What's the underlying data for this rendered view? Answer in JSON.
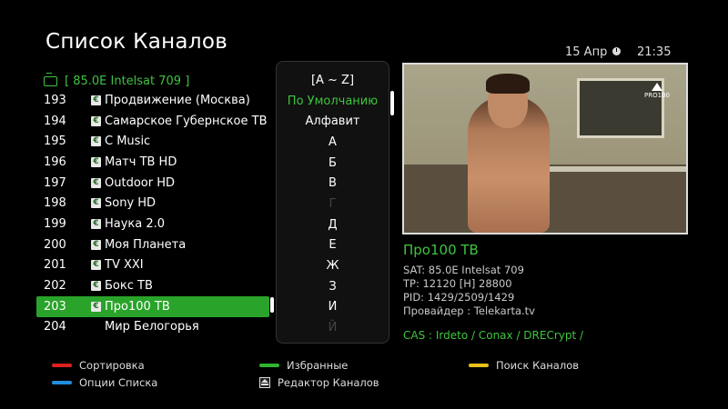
{
  "header": {
    "title": "Список Каналов",
    "date": "15 Апр",
    "time": "21:35"
  },
  "satellite": {
    "label": "[ 85.0E Intelsat 709 ]",
    "icon": "tv-icon",
    "color": "#3ec43e"
  },
  "channels": [
    {
      "num": "193",
      "name": "Продвижение (Москва)",
      "free": true
    },
    {
      "num": "194",
      "name": "Самарское Губернское ТВ",
      "free": true
    },
    {
      "num": "195",
      "name": "C Music",
      "free": true
    },
    {
      "num": "196",
      "name": "Матч ТВ HD",
      "free": true
    },
    {
      "num": "197",
      "name": "Outdoor HD",
      "free": true
    },
    {
      "num": "198",
      "name": "Sony HD",
      "free": true
    },
    {
      "num": "199",
      "name": "Наука 2.0",
      "free": true
    },
    {
      "num": "200",
      "name": "Моя Планета",
      "free": true
    },
    {
      "num": "201",
      "name": "TV XXI",
      "free": true
    },
    {
      "num": "202",
      "name": "Бокс ТВ",
      "free": true
    },
    {
      "num": "203",
      "name": "Про100 ТВ",
      "free": true,
      "selected": true
    },
    {
      "num": "204",
      "name": "Мир Белогорья",
      "free": false
    }
  ],
  "free_icon_glyph": "€",
  "sort_menu": {
    "header": "[A ~ Z]",
    "items": [
      {
        "label": "По Умолчанию",
        "state": "active"
      },
      {
        "label": "Алфавит",
        "state": "normal"
      },
      {
        "label": "А",
        "state": "normal"
      },
      {
        "label": "Б",
        "state": "normal"
      },
      {
        "label": "В",
        "state": "normal"
      },
      {
        "label": "Г",
        "state": "dim"
      },
      {
        "label": "Д",
        "state": "normal"
      },
      {
        "label": "Е",
        "state": "normal"
      },
      {
        "label": "Ж",
        "state": "normal"
      },
      {
        "label": "З",
        "state": "normal"
      },
      {
        "label": "И",
        "state": "normal"
      },
      {
        "label": "Й",
        "state": "dim"
      }
    ]
  },
  "preview": {
    "logo_text": "PRO100"
  },
  "info": {
    "name": "Про100 ТВ",
    "sat": "SAT: 85.0E Intelsat 709",
    "tp": "TP: 12120 [H] 28800",
    "pid": "PID: 1429/2509/1429",
    "provider": "Провайдер : Telekarta.tv",
    "cas": "CAS : Irdeto / Conax / DRECrypt /"
  },
  "legend": {
    "red": {
      "label": "Сортировка",
      "color": "#e02020"
    },
    "green": {
      "label": "Избранные",
      "color": "#2fb52f"
    },
    "yellow": {
      "label": "Поиск Каналов",
      "color": "#e8c21a"
    },
    "blue": {
      "label": "Опции Списка",
      "color": "#1f8fe0"
    },
    "eject": {
      "label": "Редактор Каналов",
      "icon": "eject-icon"
    }
  },
  "colors": {
    "accent_green": "#3ec43e",
    "selected_bg": "#29a329",
    "background": "#000000"
  }
}
